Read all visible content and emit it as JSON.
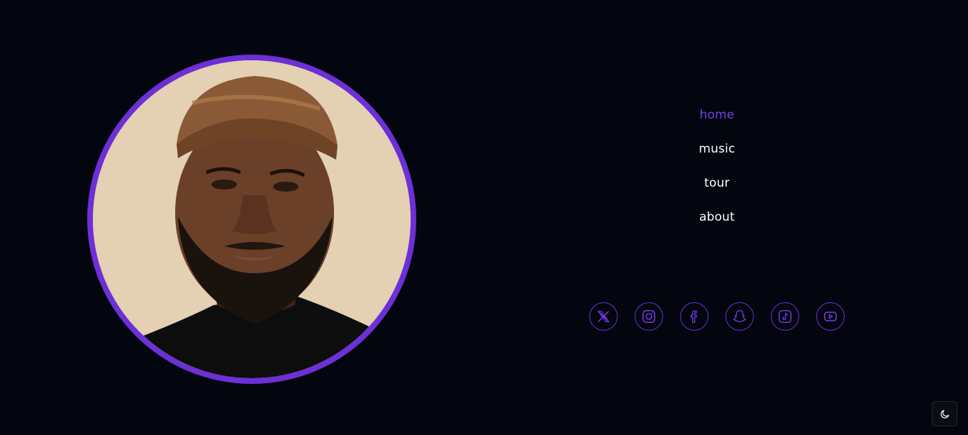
{
  "profile": {
    "image": "portrait-photo",
    "ring_color": "#6d2fd6"
  },
  "nav": {
    "active_color": "#7c3aed",
    "items": [
      {
        "label": "home"
      },
      {
        "label": "music"
      },
      {
        "label": "tour"
      },
      {
        "label": "about"
      }
    ]
  },
  "social": {
    "accent": "#6d2fd6",
    "links": [
      {
        "icon": "x-twitter-icon"
      },
      {
        "icon": "instagram-icon"
      },
      {
        "icon": "facebook-icon"
      },
      {
        "icon": "snapchat-icon"
      },
      {
        "icon": "tiktok-icon"
      },
      {
        "icon": "youtube-icon"
      }
    ]
  },
  "theme_toggle": {
    "icon": "moon-icon"
  },
  "colors": {
    "background": "#04060f",
    "text": "#ffffff"
  }
}
